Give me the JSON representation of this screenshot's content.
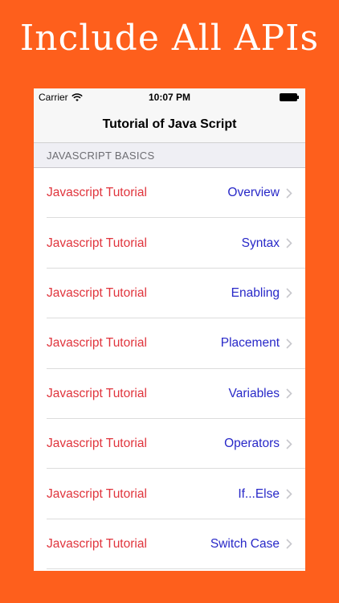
{
  "promo": {
    "title": "Include All APIs"
  },
  "status_bar": {
    "carrier": "Carrier",
    "time": "10:07 PM"
  },
  "nav": {
    "title": "Tutorial of Java Script"
  },
  "section": {
    "header": "JAVASCRIPT BASICS"
  },
  "items": [
    {
      "left": "Javascript Tutorial",
      "right": "Overview"
    },
    {
      "left": "Javascript Tutorial",
      "right": "Syntax"
    },
    {
      "left": "Javascript Tutorial",
      "right": "Enabling"
    },
    {
      "left": "Javascript Tutorial",
      "right": "Placement"
    },
    {
      "left": "Javascript Tutorial",
      "right": "Variables"
    },
    {
      "left": "Javascript Tutorial",
      "right": "Operators"
    },
    {
      "left": "Javascript Tutorial",
      "right": "If...Else"
    },
    {
      "left": "Javascript Tutorial",
      "right": "Switch Case"
    }
  ],
  "colors": {
    "background": "#fe5f1c",
    "left_text": "#e0343c",
    "right_text": "#2828c8"
  }
}
